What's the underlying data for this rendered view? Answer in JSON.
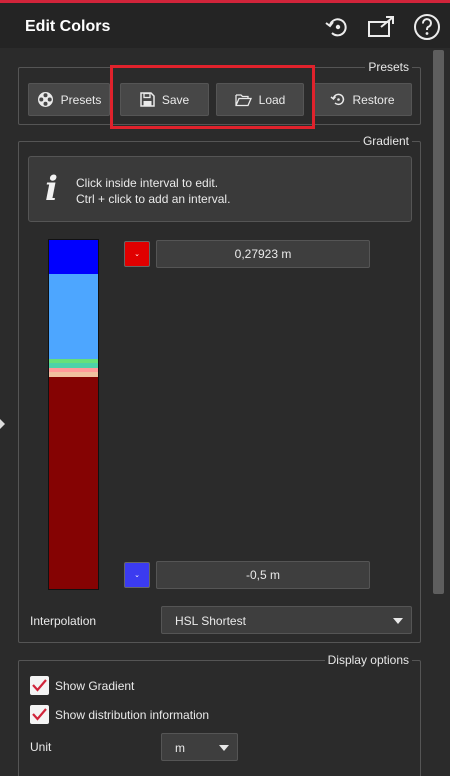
{
  "header": {
    "title": "Edit Colors",
    "icons": [
      "reset-icon",
      "popout-icon",
      "help-icon"
    ],
    "accent_color": "#d0243a"
  },
  "presets": {
    "legend": "Presets",
    "buttons": {
      "presets": "Presets",
      "save": "Save",
      "load": "Load",
      "restore": "Restore"
    }
  },
  "gradient": {
    "legend": "Gradient",
    "info_line1": "Click inside interval to edit.",
    "info_line2": "Ctrl + click to add an interval.",
    "top_value": "0,27923 m",
    "bottom_value": "-0,5 m",
    "top_color": "#e00000",
    "bottom_color": "#3b3bf0",
    "bar_colors": [
      "#0000ff",
      "#4da6ff",
      "#66e07a",
      "#4dd2a8",
      "#ff9a9a",
      "#f0c0a0",
      "#850303"
    ]
  },
  "interpolation": {
    "label": "Interpolation",
    "value": "HSL Shortest"
  },
  "display_options": {
    "legend": "Display options",
    "show_gradient": "Show Gradient",
    "show_distribution": "Show distribution information",
    "unit_label": "Unit",
    "unit_value": "m"
  }
}
